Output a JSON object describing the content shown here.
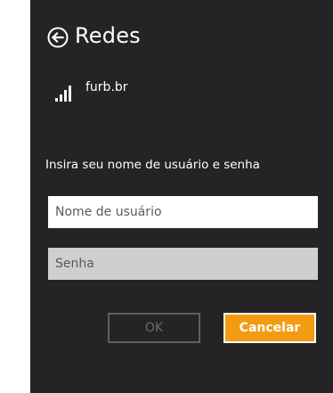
{
  "header": {
    "title": "Redes",
    "back_icon": "back-arrow-circle-icon"
  },
  "network": {
    "name": "furb.br",
    "signal_icon": "wifi-signal-icon",
    "signal_strength": 4
  },
  "form": {
    "prompt": "Insira seu nome de usuário e senha",
    "username_placeholder": "Nome de usuário",
    "password_placeholder": "Senha"
  },
  "buttons": {
    "ok_label": "OK",
    "cancel_label": "Cancelar"
  },
  "colors": {
    "background": "#242424",
    "accent": "#f39c12",
    "disabled_text": "#6c6c6c"
  }
}
